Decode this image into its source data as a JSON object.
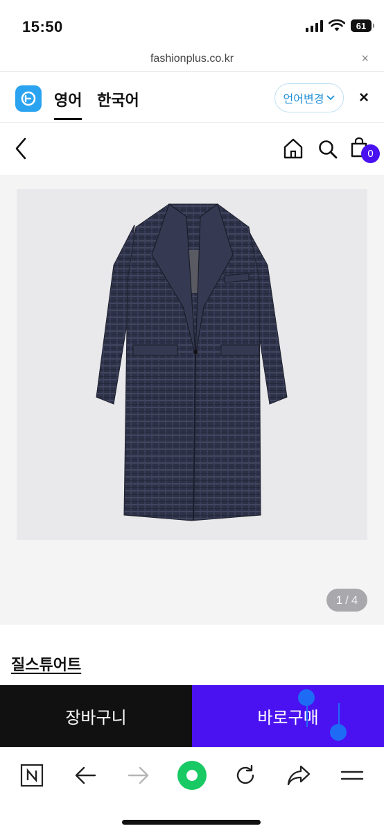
{
  "status_bar": {
    "time": "15:50",
    "battery": "61"
  },
  "url_bar": {
    "url": "fashionplus.co.kr",
    "close": "×"
  },
  "translate_bar": {
    "tabs": [
      "영어",
      "한국어"
    ],
    "active_tab": "영어",
    "change_language_label": "언어변경",
    "close": "×"
  },
  "header": {
    "cart_count": "0"
  },
  "gallery": {
    "current": "1",
    "separator": "/",
    "total": "4"
  },
  "product": {
    "brand": "질스튜어트"
  },
  "actions": {
    "cart_label": "장바구니",
    "buy_label": "바로구매"
  },
  "colors": {
    "accent": "#4a12f0",
    "dark": "#111111",
    "translate_blue": "#2aa3f0",
    "toolbar_green": "#18c964"
  },
  "toolbar_icons": [
    "naver-n-icon",
    "back-arrow-icon",
    "forward-arrow-icon",
    "green-dot-icon",
    "reload-icon",
    "share-icon",
    "menu-icon"
  ]
}
